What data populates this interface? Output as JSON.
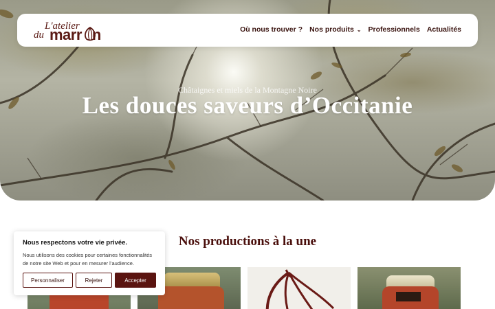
{
  "brand": {
    "logo_line1": "L'atelier",
    "logo_du": "du",
    "logo_marron": "marr",
    "logo_end": "n",
    "color": "#5a1a14"
  },
  "nav": {
    "items": [
      {
        "label": "Où nous trouver ?"
      },
      {
        "label": "Nos produits",
        "icon": "chevron-down-icon"
      },
      {
        "label": "Professionnels"
      },
      {
        "label": "Actualités"
      }
    ]
  },
  "hero": {
    "subtitle": "Châtaignes et miels de la Montagne Noire",
    "title": "Les douces saveurs d’Occitanie"
  },
  "section": {
    "title": "Nos productions à la une"
  },
  "cookie": {
    "title": "Nous respectons votre vie privée.",
    "text": "Nous utilisons des cookies pour certaines fonctionnalités de notre site Web et pour en mesurer l’audience.",
    "customize_label": "Personnaliser",
    "reject_label": "Rejeter",
    "accept_label": "Accepter"
  },
  "colors": {
    "accent": "#5a1410",
    "title": "#4a0f0c"
  }
}
